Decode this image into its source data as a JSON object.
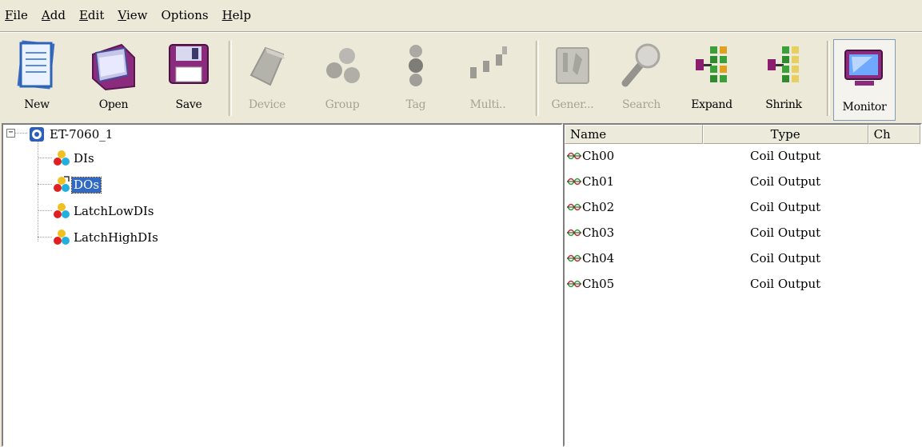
{
  "menu": {
    "items": [
      {
        "label": "File",
        "accel": "F",
        "rest": "ile"
      },
      {
        "label": "Add",
        "accel": "A",
        "rest": "dd"
      },
      {
        "label": "Edit",
        "accel": "E",
        "rest": "dit"
      },
      {
        "label": "View",
        "accel": "V",
        "rest": "iew"
      },
      {
        "label": "Options",
        "accel": "",
        "rest": "Options"
      },
      {
        "label": "Help",
        "accel": "H",
        "rest": "elp"
      }
    ]
  },
  "toolbar": {
    "new": "New",
    "open": "Open",
    "save": "Save",
    "device": "Device",
    "group": "Group",
    "tag": "Tag",
    "multi": "Multi..",
    "gener": "Gener...",
    "search": "Search",
    "expand": "Expand",
    "shrink": "Shrink",
    "monitor": "Monitor"
  },
  "tree": {
    "root": "ET-7060_1",
    "expander": "−",
    "children": [
      "DIs",
      "DOs",
      "LatchLowDIs",
      "LatchHighDIs"
    ],
    "selected": "DOs"
  },
  "list": {
    "headers": [
      "Name",
      "Type",
      "Ch"
    ],
    "rows": [
      {
        "name": "Ch00",
        "type": "Coil Output"
      },
      {
        "name": "Ch01",
        "type": "Coil Output"
      },
      {
        "name": "Ch02",
        "type": "Coil Output"
      },
      {
        "name": "Ch03",
        "type": "Coil Output"
      },
      {
        "name": "Ch04",
        "type": "Coil Output"
      },
      {
        "name": "Ch05",
        "type": "Coil Output"
      }
    ]
  },
  "colors": {
    "selection": "#316ac5",
    "window_bg": "#ece9d8",
    "disabled_text": "#a6a396"
  }
}
